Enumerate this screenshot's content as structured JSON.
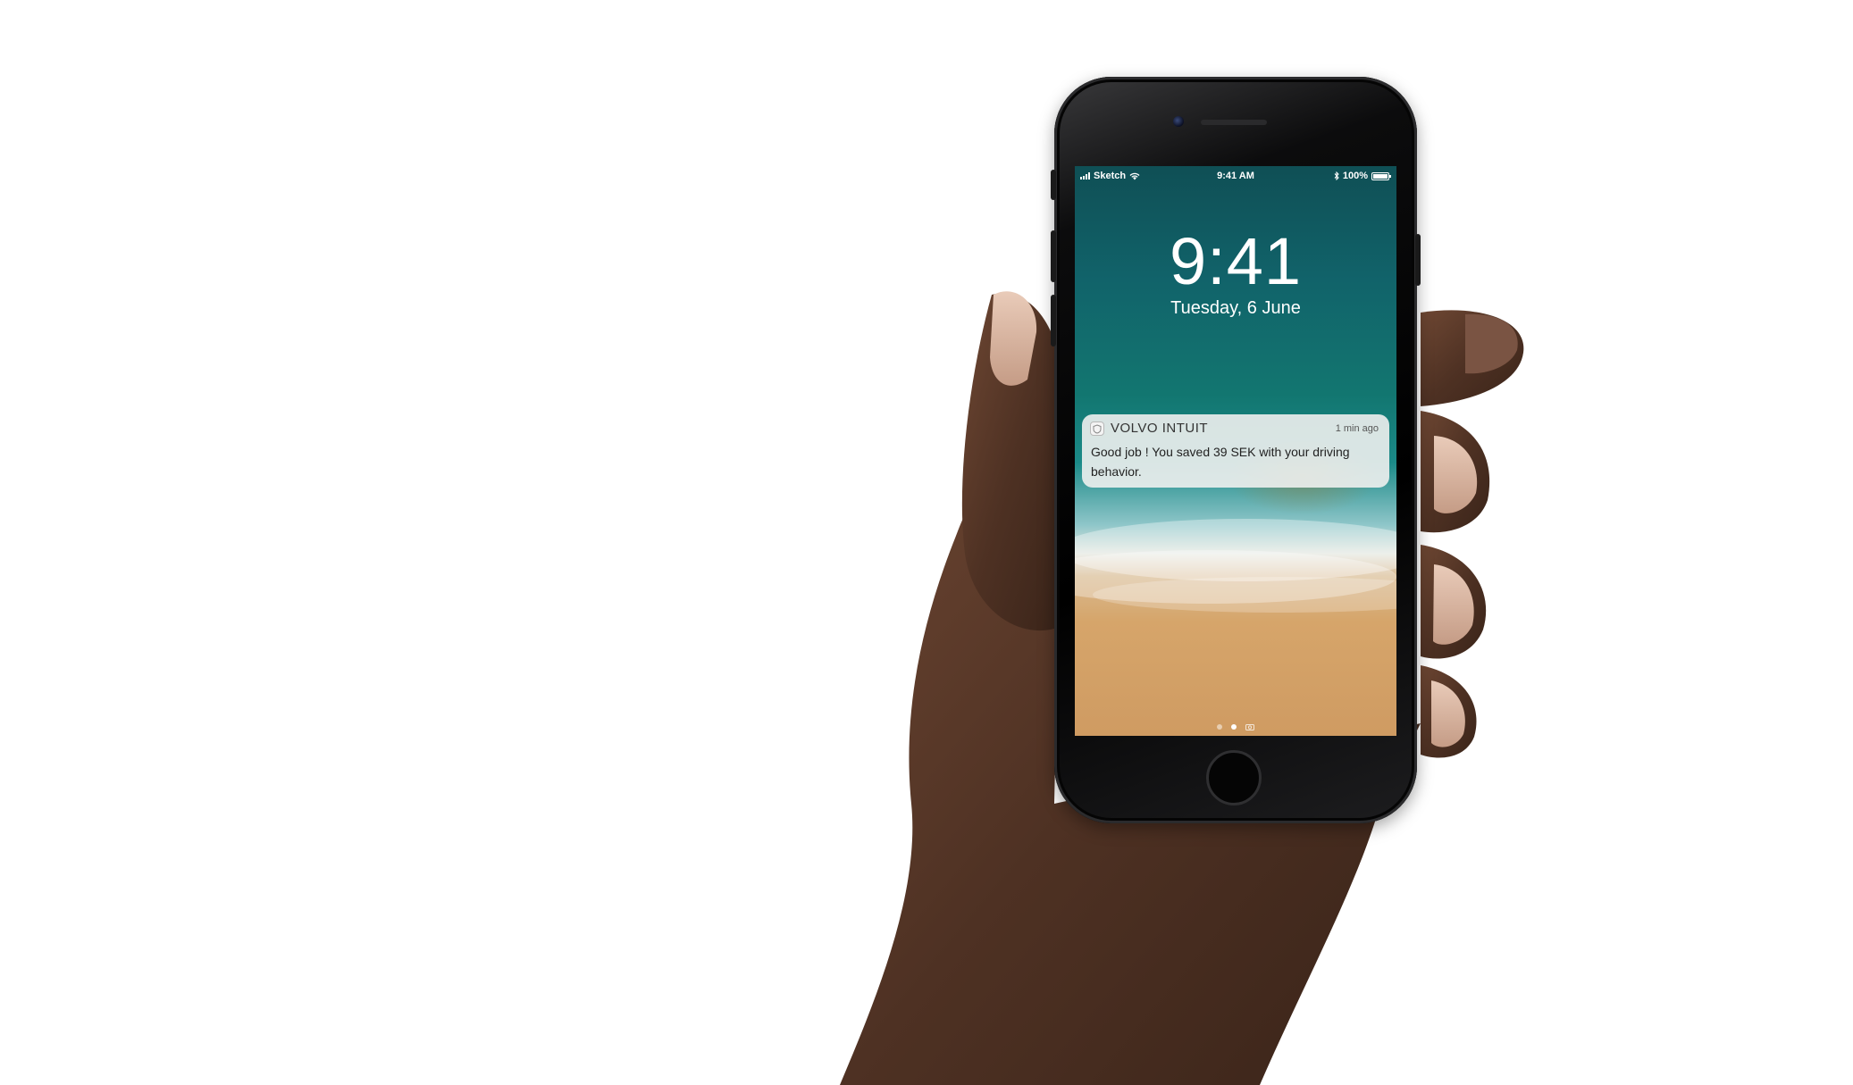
{
  "lockscreen": {
    "status_bar": {
      "carrier": "Sketch",
      "time": "9:41 AM",
      "battery": "100%"
    },
    "clock_time": "9:41",
    "date": "Tuesday, 6 June",
    "notification": {
      "app_name": "VOLVO INTUIT",
      "time_ago": "1 min ago",
      "message": "Good job ! You saved 39 SEK with your driving behavior."
    },
    "page_indicator": {
      "count": 2,
      "active_index": 1,
      "trailing_icon": "camera-icon"
    }
  },
  "colors": {
    "background": "#ffffff",
    "phone_body": "#000000",
    "skin": "#5a3a2a",
    "sea": "#127670",
    "sand": "#d6a56a"
  }
}
